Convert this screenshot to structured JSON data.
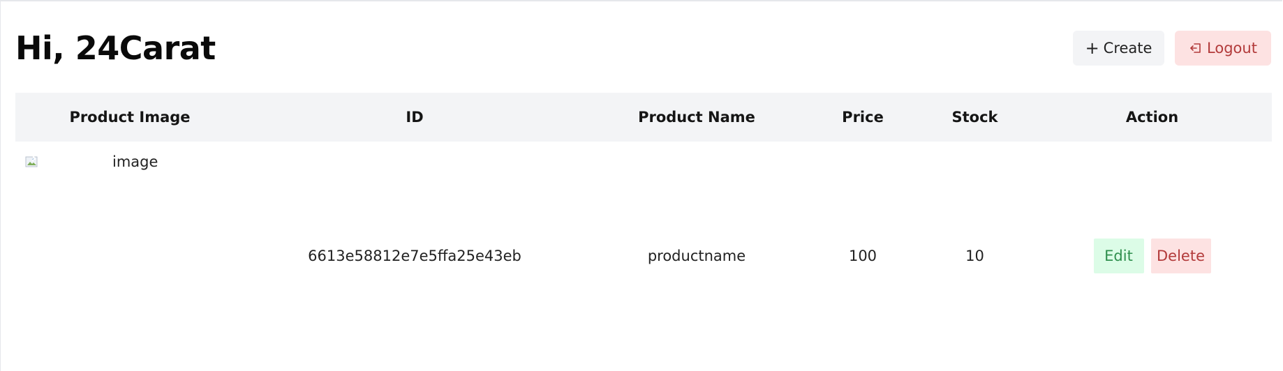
{
  "header": {
    "greeting": "Hi, 24Carat",
    "create_label": "Create",
    "logout_label": "Logout"
  },
  "table": {
    "columns": [
      "Product Image",
      "ID",
      "Product Name",
      "Price",
      "Stock",
      "Action"
    ],
    "rows": [
      {
        "image_alt": "image",
        "id": "6613e58812e7e5ffa25e43eb",
        "name": "productname",
        "price": "100",
        "stock": "10",
        "edit_label": "Edit",
        "delete_label": "Delete"
      }
    ]
  },
  "icons": {
    "create": "plus-icon",
    "logout": "logout-icon",
    "image": "broken-image-icon"
  },
  "colors": {
    "header_bg": "#f3f4f6",
    "create_bg": "#f3f4f6",
    "logout_bg": "#fde2e2",
    "logout_text": "#b23a3a",
    "edit_bg": "#dcfce7",
    "edit_text": "#2f8f4e",
    "delete_bg": "#fde2e2",
    "delete_text": "#b23a3a"
  }
}
